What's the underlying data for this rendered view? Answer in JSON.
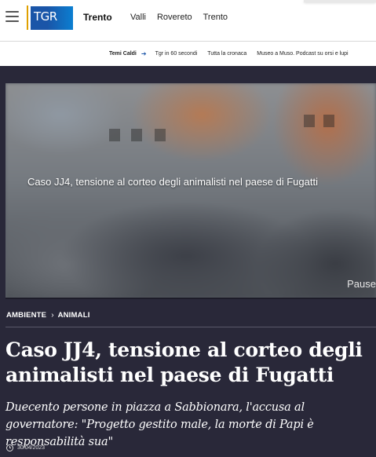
{
  "header": {
    "logo_text": "TGR",
    "region": "Trento",
    "nav": [
      "Valli",
      "Rovereto",
      "Trento"
    ]
  },
  "topics": {
    "lead": "Temi Caldi",
    "items": [
      "Tgr in 60 secondi",
      "Tutta la cronaca",
      "Museo a Muso. Podcast su orsi e lupi"
    ]
  },
  "video": {
    "caption": "Caso JJ4, tensione al corteo degli animalisti nel paese di Fugatti",
    "pause_label": "Pause"
  },
  "breadcrumb": [
    "AMBIENTE",
    "ANIMALI"
  ],
  "article": {
    "headline": "Caso JJ4, tensione al corteo degli animalisti nel paese di Fugatti",
    "subtitle": "Duecento persone in piazza a Sabbionara, l'accusa al governatore: \"Progetto gestito male, la morte di Papi è responsabilità sua\"",
    "date": "30/04/2023"
  },
  "colors": {
    "main_bg": "#292839",
    "logo_blue": "#1a55a8",
    "logo_accent": "#e0a000"
  }
}
